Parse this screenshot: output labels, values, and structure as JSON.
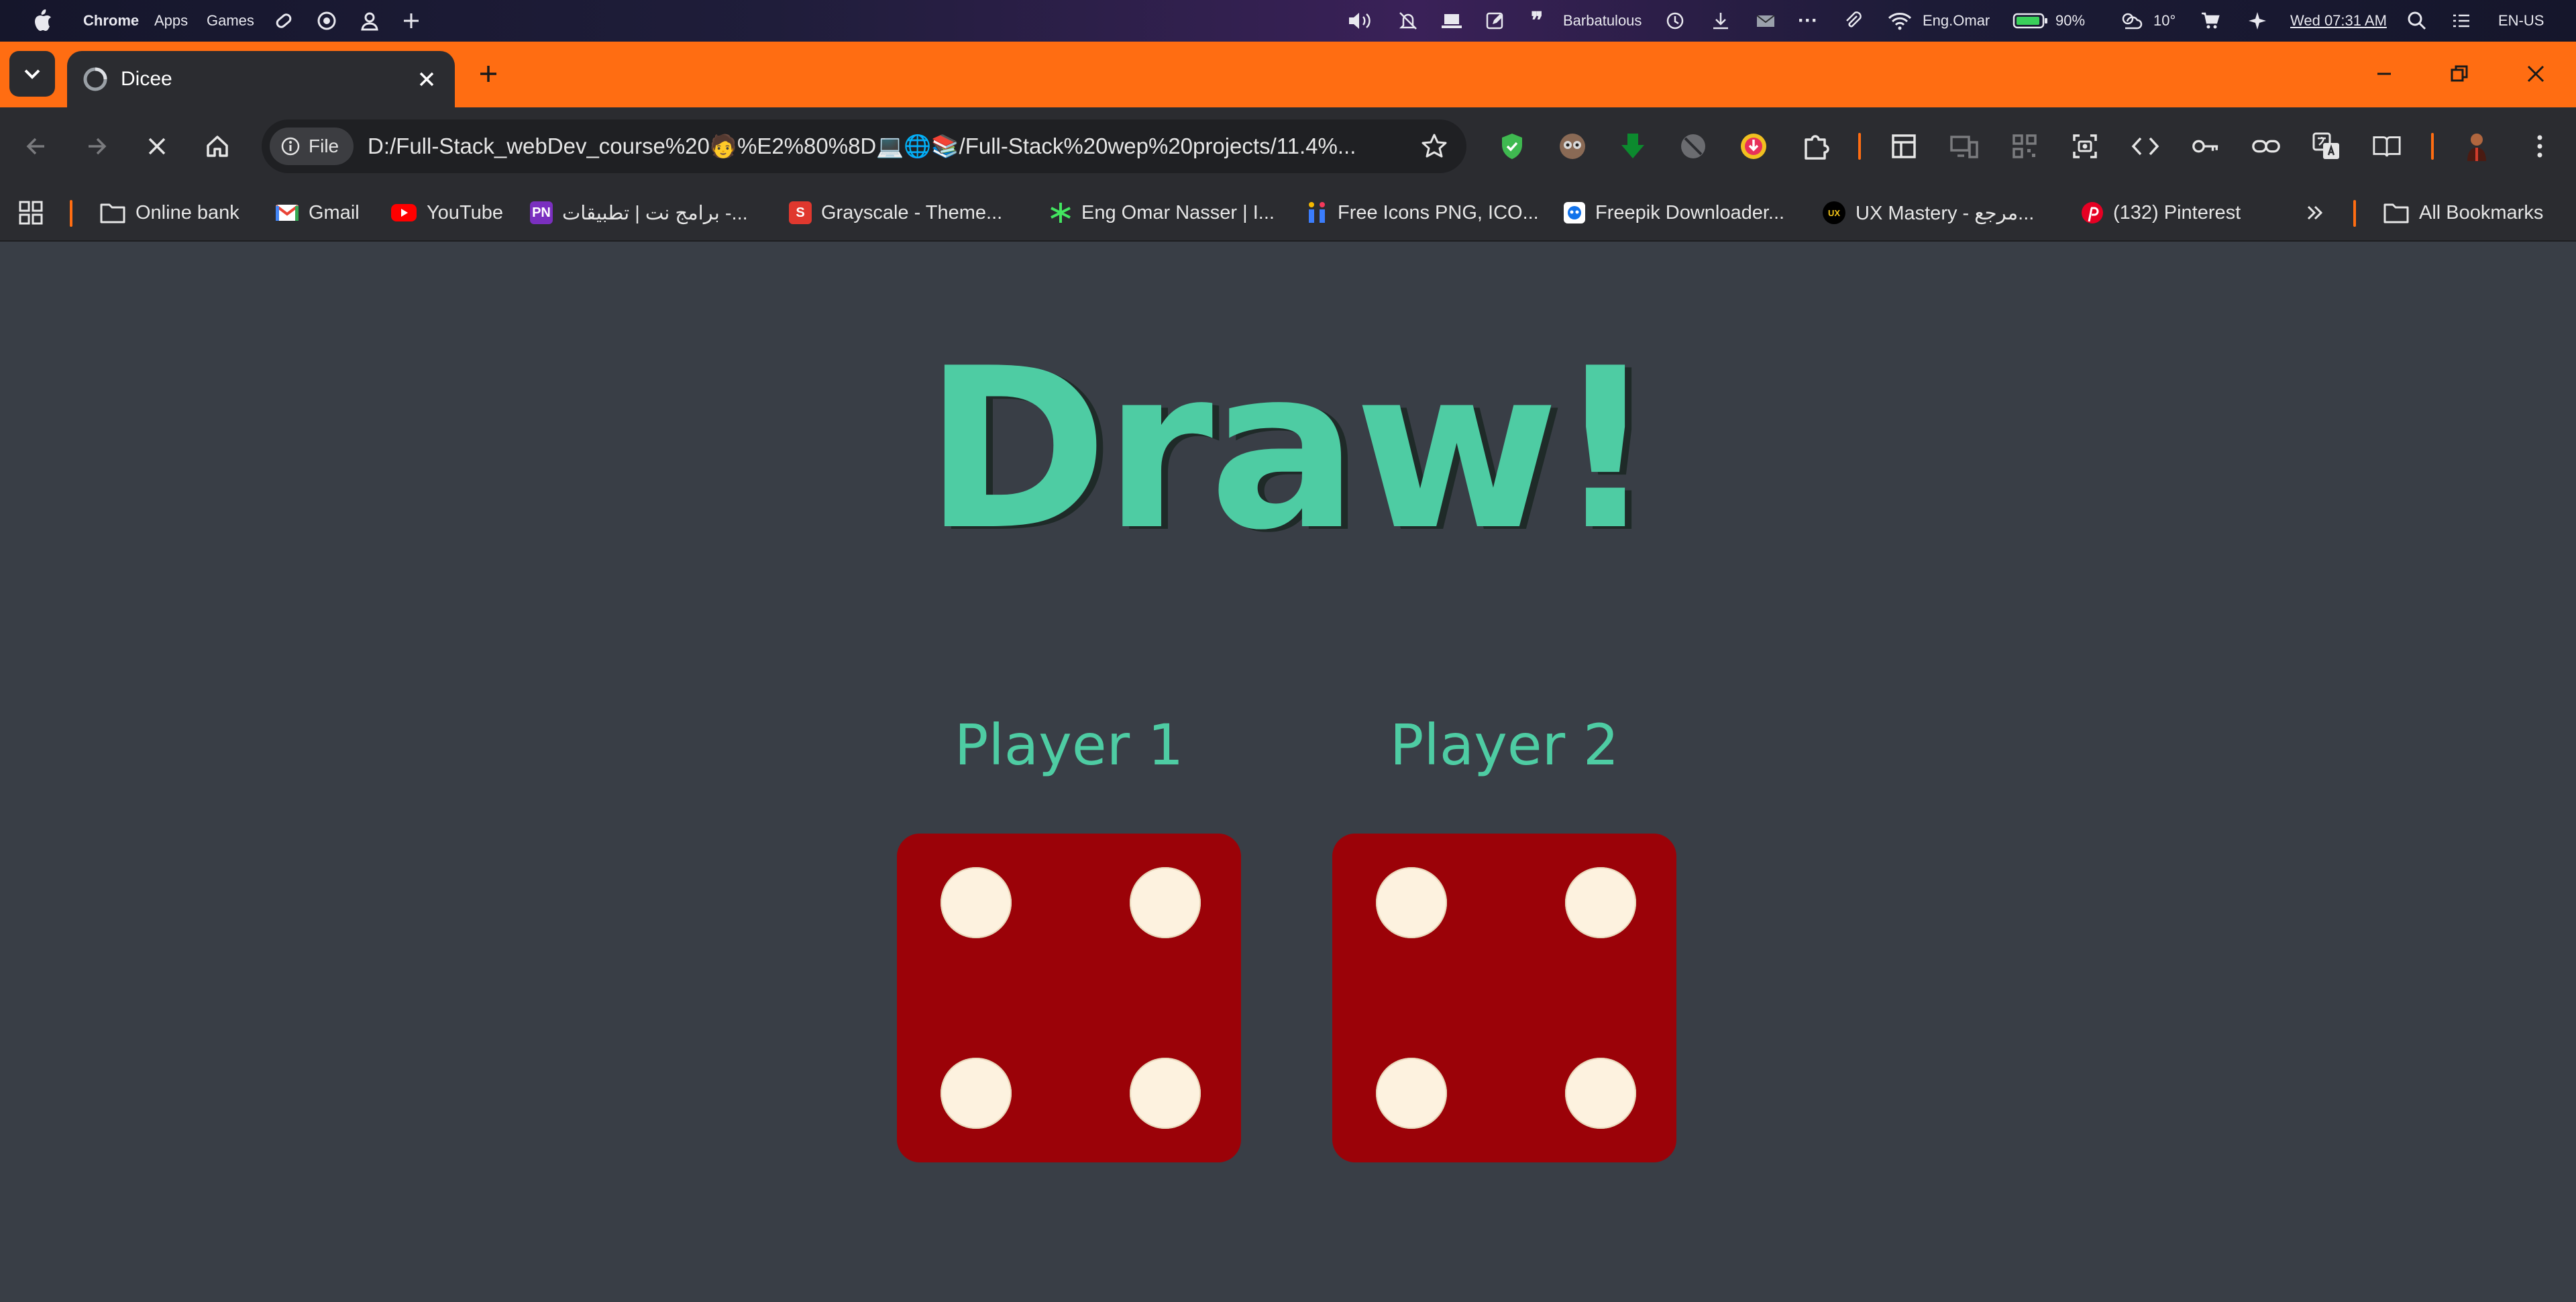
{
  "menubar": {
    "app": "Chrome",
    "menus": [
      "Apps",
      "Games"
    ],
    "user_status": "Barbatulous",
    "wifi_user": "Eng.Omar",
    "battery": "90%",
    "weather": "10°",
    "datetime": "Wed 07:31 AM",
    "locale": "EN-US"
  },
  "tab": {
    "title": "Dicee"
  },
  "omnibox": {
    "chip_label": "File",
    "url": "D:/Full-Stack_webDev_course%20🧑%E2%80%8D💻🌐📚/Full-Stack%20wep%20projects/11.4%..."
  },
  "bookmarks": [
    {
      "label": "Online bank"
    },
    {
      "label": "Gmail"
    },
    {
      "label": "YouTube"
    },
    {
      "label": "برامج نت | تطبيقات -..."
    },
    {
      "label": "Grayscale - Theme..."
    },
    {
      "label": "Eng Omar Nasser | I..."
    },
    {
      "label": "Free Icons PNG, ICO..."
    },
    {
      "label": "Freepik Downloader..."
    },
    {
      "label": "UX Mastery - مرجع..."
    },
    {
      "label": "(132) Pinterest"
    },
    {
      "label": "All Bookmarks"
    }
  ],
  "game": {
    "headline": "Draw!",
    "player1": {
      "name": "Player 1",
      "dice_value": 4
    },
    "player2": {
      "name": "Player 2",
      "dice_value": 4
    },
    "colors": {
      "background": "#393e46",
      "accent": "#4ecca3",
      "die": "#9b0208",
      "pip": "#fdf2df"
    }
  },
  "colors": {
    "tabstrip": "#ff6d12",
    "toolbar": "#2b2c30"
  }
}
